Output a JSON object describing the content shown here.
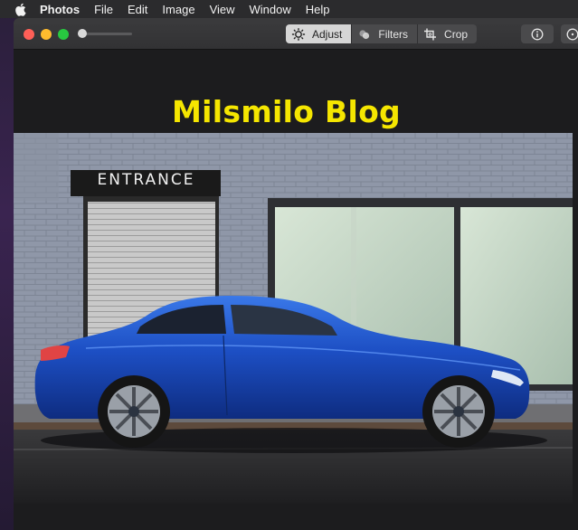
{
  "menubar": {
    "app_name": "Photos",
    "items": [
      "File",
      "Edit",
      "Image",
      "View",
      "Window",
      "Help"
    ]
  },
  "toolbar": {
    "adjust_label": "Adjust",
    "filters_label": "Filters",
    "crop_label": "Crop",
    "zoom_level": 0.0
  },
  "content": {
    "blog_title": "Milsmilo Blog",
    "sign_text": "ENTRANCE"
  },
  "colors": {
    "title_yellow": "#f5e600",
    "car_blue": "#1d4fc4",
    "close": "#fe5f57",
    "minimize": "#febc2e",
    "maximize": "#28c840"
  },
  "icons": {
    "apple": "apple-icon",
    "adjust": "adjust-sun-icon",
    "filters": "filters-circles-icon",
    "crop": "crop-icon",
    "info": "info-icon"
  }
}
